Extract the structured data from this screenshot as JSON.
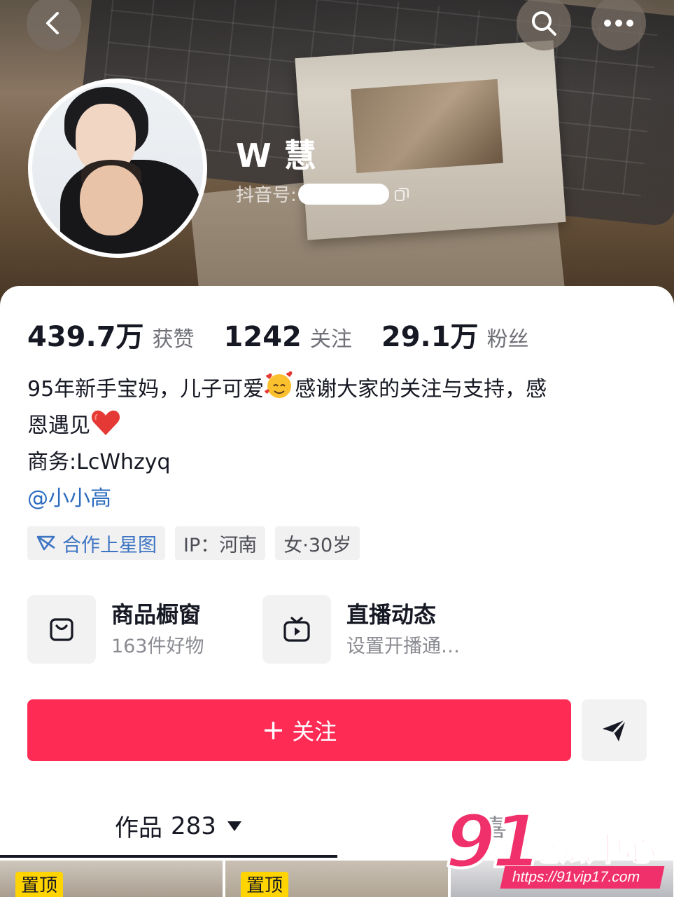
{
  "profile": {
    "name": "W 慧",
    "douyin_id_label": "抖音号:"
  },
  "stats": [
    {
      "value": "439.7万",
      "label": "获赞"
    },
    {
      "value": "1242",
      "label": "关注"
    },
    {
      "value": "29.1万",
      "label": "粉丝"
    }
  ],
  "bio": {
    "line1_a": "95年新手宝妈，儿子可爱",
    "line1_b": "感谢大家的关注与支持，感",
    "line2": "恩遇见",
    "line3": "商务:LcWhzyq",
    "mention": "@小小高"
  },
  "tags": {
    "star": "合作上星图",
    "ip": "IP：河南",
    "gender_age": "女·30岁"
  },
  "features": [
    {
      "title": "商品橱窗",
      "sub": "163件好物"
    },
    {
      "title": "直播动态",
      "sub": "设置开播通…"
    }
  ],
  "actions": {
    "follow_label": "关注",
    "follow_plus": "+"
  },
  "tabs": {
    "works_label": "作品",
    "works_count": "283",
    "second_label": "喜"
  },
  "pinned_label": "置顶",
  "watermark": {
    "num": "91",
    "text": "吃瓜中心",
    "url": "https://91vip17.com"
  },
  "colors": {
    "accent": "#fe2c55",
    "link": "#2c6bbf",
    "pin": "#ffd400"
  }
}
